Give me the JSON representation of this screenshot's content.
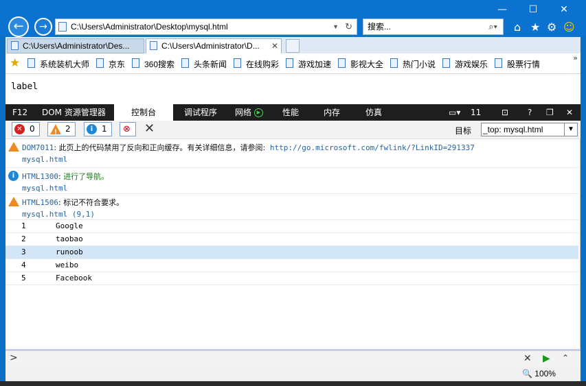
{
  "titlebar": {
    "address": "C:\\Users\\Administrator\\Desktop\\mysql.html",
    "search_placeholder": "搜索...",
    "min": "—",
    "max": "☐",
    "close": "✕"
  },
  "tabs": [
    {
      "label": "C:\\Users\\Administrator\\Des...",
      "active": false
    },
    {
      "label": "C:\\Users\\Administrator\\D...",
      "active": true
    }
  ],
  "favorites": [
    "系统装机大师",
    "京东",
    "360搜索",
    "头条新闻",
    "在线购彩",
    "游戏加速",
    "影视大全",
    "热门小说",
    "游戏娱乐",
    "股票行情"
  ],
  "page": {
    "label": "label"
  },
  "devtools": {
    "tabs": [
      "F12",
      "DOM 资源管理器",
      "控制台",
      "调试程序",
      "网络",
      "性能",
      "内存",
      "仿真"
    ],
    "count": "11",
    "counts": {
      "errors": "0",
      "warnings": "2",
      "info": "1"
    },
    "target_label": "目标",
    "target_value": "_top: mysql.html"
  },
  "console": {
    "messages": [
      {
        "type": "warning",
        "code": "DOM7011",
        "text": "此页上的代码禁用了反向和正向缓存。有关详细信息，请参阅:",
        "link": "http://go.microsoft.com/fwlink/?LinkID=291337",
        "source": "mysql.html"
      },
      {
        "type": "info",
        "code": "HTML1300",
        "text": "进行了导航。",
        "source": "mysql.html"
      },
      {
        "type": "warning",
        "code": "HTML1506",
        "text": "标记不符合要求。",
        "source": "mysql.html (9,1)"
      }
    ],
    "rows": [
      {
        "id": "1",
        "name": "Google"
      },
      {
        "id": "2",
        "name": "taobao"
      },
      {
        "id": "3",
        "name": "runoob"
      },
      {
        "id": "4",
        "name": "weibo"
      },
      {
        "id": "5",
        "name": "Facebook"
      }
    ]
  },
  "input": {
    "prompt": ">"
  },
  "status": {
    "zoom": "100%"
  }
}
